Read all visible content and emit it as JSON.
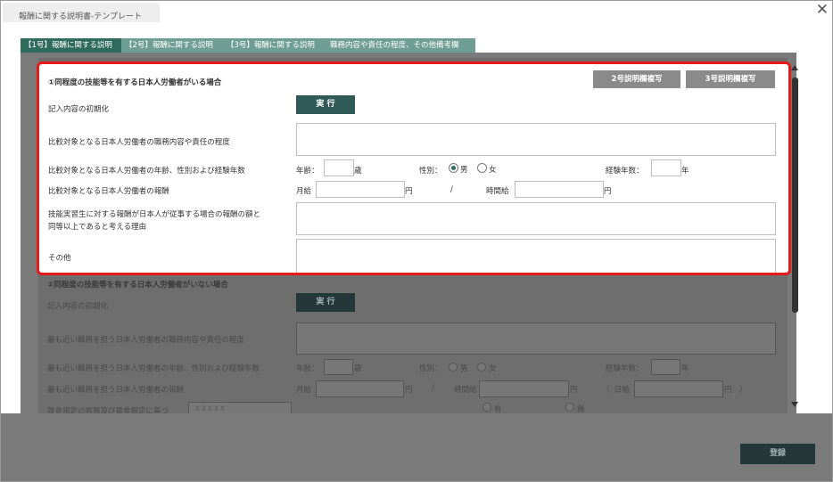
{
  "window": {
    "title": "報酬に関する説明書-テンプレート",
    "close_symbol": "✕"
  },
  "tabs": [
    {
      "label": "【1号】報酬に関する説明"
    },
    {
      "label": "【2号】報酬に関する説明"
    },
    {
      "label": "【3号】報酬に関する説明"
    },
    {
      "label": "職務内容や責任の程度、その他備考欄"
    }
  ],
  "section1": {
    "heading": "①同程度の技能等を有する日本人労働者がいる場合",
    "copy2_label": "2号説明欄複写",
    "copy3_label": "3号説明欄複写",
    "init_label": "記入内容の初期化",
    "exec_label": "実 行",
    "duties_label": "比較対象となる日本人労働者の職務内容や責任の程度",
    "age_row_label": "比較対象となる日本人労働者の年齢、性別および経験年数",
    "age_prefix": "年齢：",
    "age_suffix": "歳",
    "gender_prefix": "性別：",
    "gender_male": "男",
    "gender_female": "女",
    "gender_selected": "男",
    "exp_prefix": "経験年数：",
    "exp_suffix": "年",
    "pay_row_label": "比較対象となる日本人労働者の報酬",
    "monthly_prefix": "月給",
    "yen": "円",
    "slash": "/",
    "hourly_prefix": "時間給",
    "reason_label_1": "技能実習生に対する報酬が日本人が従事する場合の報酬の額と",
    "reason_label_2": "同等以上であると考える理由",
    "other_label": "その他"
  },
  "section2": {
    "heading": "②同程度の技能等を有する日本人労働者がいない場合",
    "init_label": "記入内容の初期化",
    "exec_label": "実 行",
    "duties_label": "最も近い職務を担う日本人労働者の職務内容や責任の程度",
    "age_row_label": "最も近い職務を担う日本人労働者の年齢、性別および経験年数",
    "age_prefix": "年齢：",
    "age_suffix": "歳",
    "gender_prefix": "性別：",
    "gender_male": "男",
    "gender_female": "女",
    "exp_prefix": "経験年数：",
    "exp_suffix": "年",
    "pay_row_label": "最も近い職務を担う日本人労働者の報酬",
    "monthly_prefix": "月給",
    "yen": "円",
    "slash": "/",
    "hourly_prefix": "時間給",
    "daily_open": "（",
    "daily_prefix": "日給",
    "daily_close": "）",
    "partial_label": "賃金規定の有無及び賃金規定に基づ",
    "partial_select": "ＸＸＸＸＸ",
    "radio_yes": "有",
    "radio_no": "無"
  },
  "footer": {
    "register_label": "登録"
  }
}
